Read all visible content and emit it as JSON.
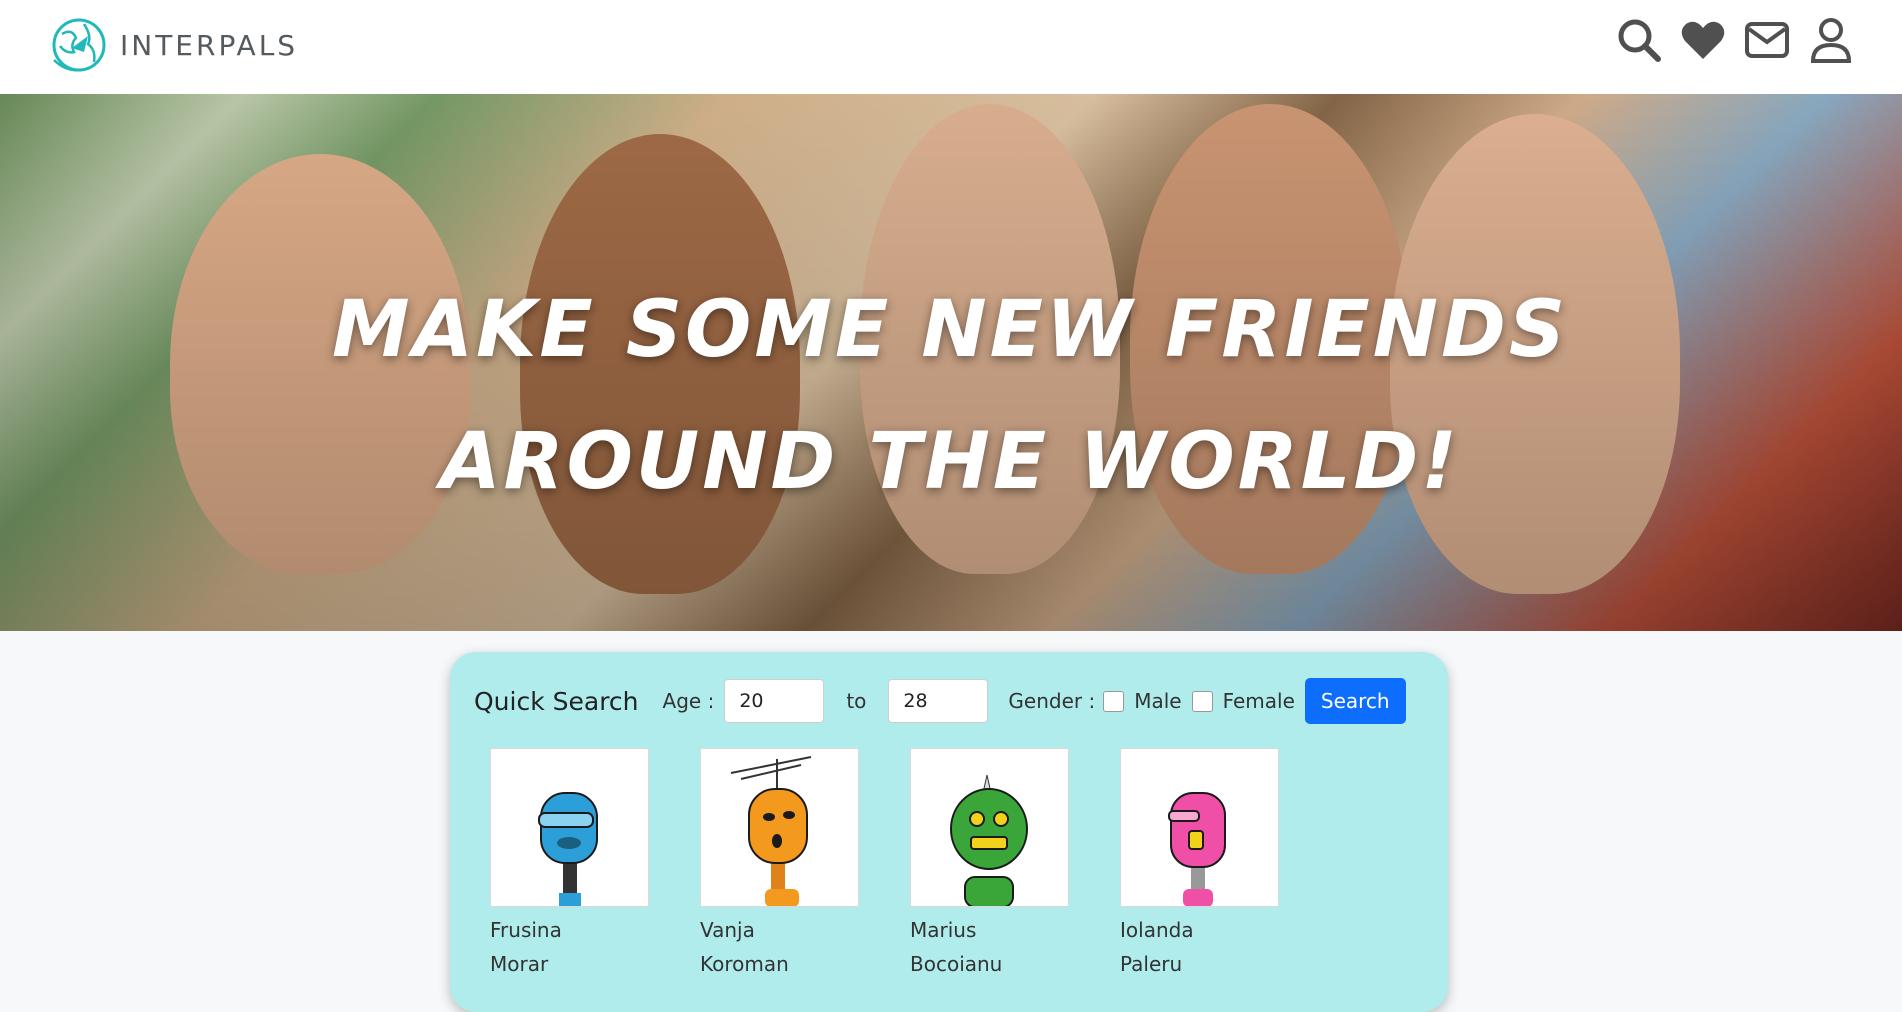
{
  "header": {
    "brand": "INTERPALS",
    "icons": [
      "search-icon",
      "heart-icon",
      "mail-icon",
      "user-icon"
    ]
  },
  "hero": {
    "title": "Make some new friends around the world!"
  },
  "quick_search": {
    "title": "Quick Search",
    "age_label": "Age :",
    "age_min": "20",
    "to_label": "to",
    "age_max": "28",
    "gender_label": "Gender :",
    "male_label": "Male",
    "female_label": "Female",
    "search_button": "Search"
  },
  "profiles": [
    {
      "first": "Frusina",
      "last": "Morar",
      "color": "#2d9fd8"
    },
    {
      "first": "Vanja",
      "last": "Koroman",
      "color": "#f39a1e"
    },
    {
      "first": "Marius",
      "last": "Bocoianu",
      "color": "#3aa63a"
    },
    {
      "first": "Iolanda",
      "last": "Paleru",
      "color": "#ef4fa6"
    }
  ],
  "colors": {
    "panel": "#b0ecec",
    "button": "#0d6efd",
    "brand_teal": "#1fb9b9"
  }
}
